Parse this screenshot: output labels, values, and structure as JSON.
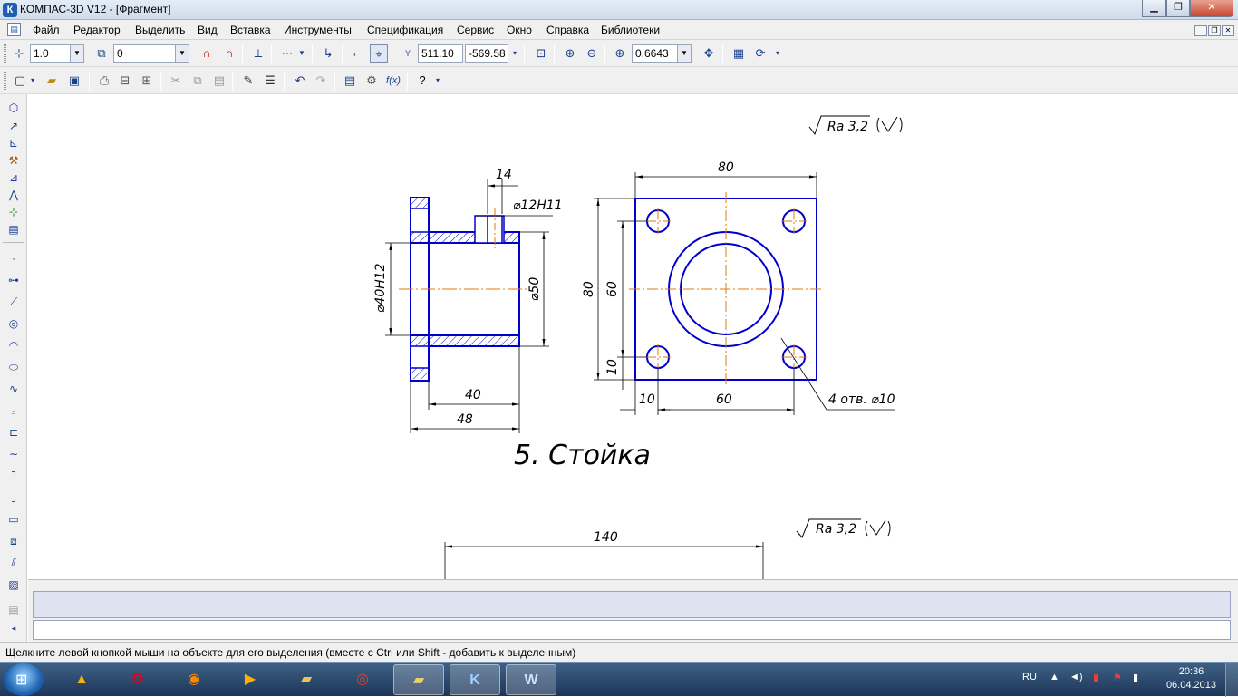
{
  "window": {
    "title": "КОМПАС-3D V12 - [Фрагмент]",
    "app_icon": "К"
  },
  "menu": [
    "Файл",
    "Редактор",
    "Выделить",
    "Вид",
    "Вставка",
    "Инструменты",
    "Спецификация",
    "Сервис",
    "Окно",
    "Справка",
    "Библиотеки"
  ],
  "toolbar": {
    "step_value": "1.0",
    "layer_value": "0",
    "coord_x": "511.10",
    "coord_y": "-569.58",
    "zoom_value": "0.6643"
  },
  "drawing": {
    "roughness_1": "Ra 3,2",
    "roughness_2": "Ra 3,2",
    "dim_14": "14",
    "dim_d12": "⌀12H11",
    "dim_d40": "⌀40H12",
    "dim_d50": "⌀50",
    "dim_40": "40",
    "dim_48": "48",
    "dim_80_top": "80",
    "dim_80_left": "80",
    "dim_60_left": "60",
    "dim_10_left": "10",
    "dim_10_bottom": "10",
    "dim_60_bottom": "60",
    "holes_label": "4 отв. ⌀10",
    "part_title": "5. Стойка",
    "dim_140": "140"
  },
  "status": {
    "message": "Щелкните левой кнопкой мыши на объекте для его выделения (вместе с Ctrl или Shift - добавить к выделенным)"
  },
  "taskbar": {
    "lang": "RU",
    "time": "20:36",
    "date": "06.04.2013",
    "apps": [
      "avast-icon",
      "opera-icon",
      "firefox-icon",
      "media-player-icon",
      "explorer-folder-icon",
      "chrome-icon",
      "folder-icon",
      "kompas-icon",
      "word-icon"
    ]
  },
  "colors": {
    "line_main": "#0000cc",
    "axis": "#e07a10",
    "dim": "#000000"
  }
}
